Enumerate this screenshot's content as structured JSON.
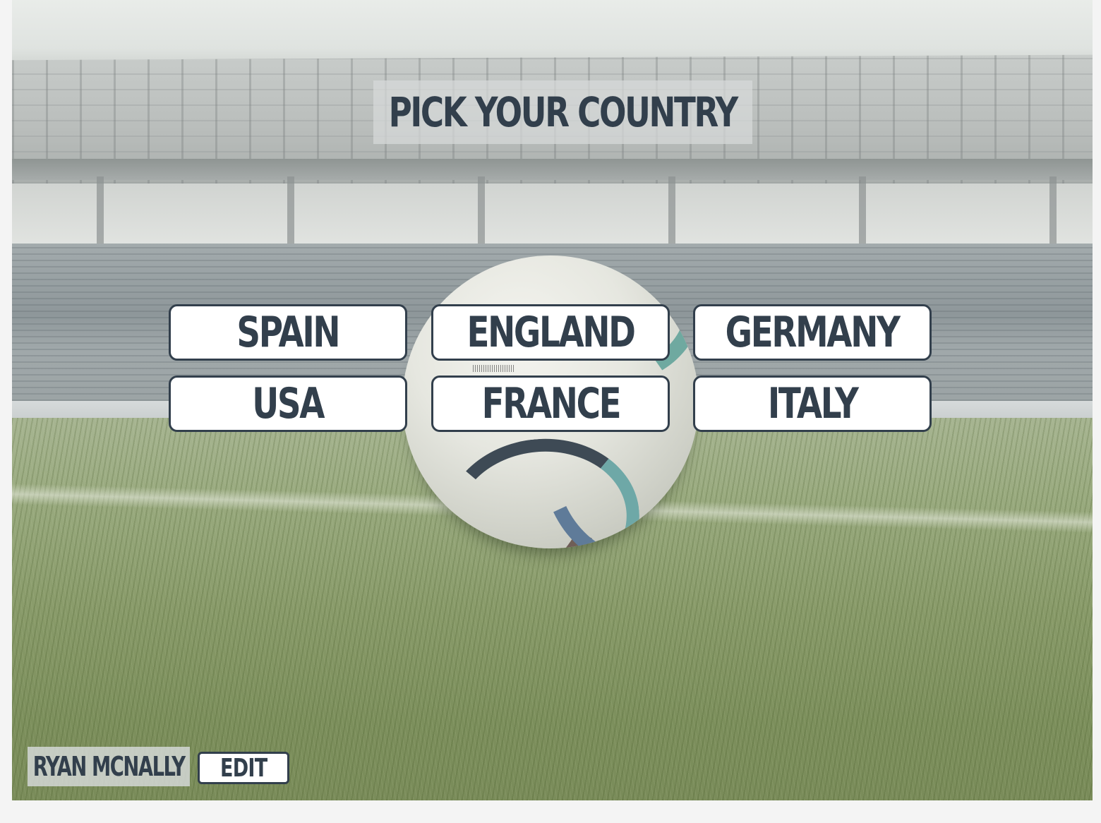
{
  "title": "PICK YOUR COUNTRY",
  "countries": [
    {
      "label": "SPAIN"
    },
    {
      "label": "ENGLAND"
    },
    {
      "label": "GERMANY"
    },
    {
      "label": "USA"
    },
    {
      "label": "FRANCE"
    },
    {
      "label": "ITALY"
    }
  ],
  "player": {
    "name": "RYAN MCNALLY",
    "edit_label": "EDIT"
  },
  "colors": {
    "text": "#323f4c",
    "button_bg": "#ffffff",
    "page_bg": "#f4f4f4"
  }
}
